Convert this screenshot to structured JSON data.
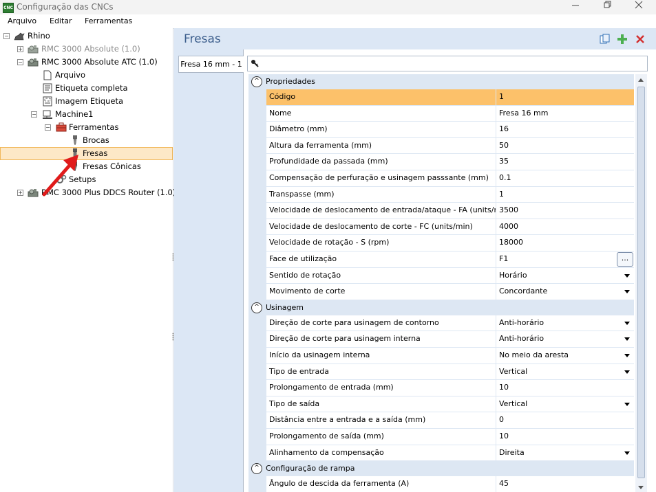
{
  "window": {
    "title": "Configuração das CNCs",
    "app_icon": "CNC"
  },
  "menu": {
    "items": [
      "Arquivo",
      "Editar",
      "Ferramentas"
    ]
  },
  "tree": {
    "root": "Rhino",
    "machines": [
      "RMC 3000 Absolute (1.0)",
      "RMC 3000 Absolute ATC (1.0)",
      "RMC 3000 Plus DDCS Router (1.0)"
    ],
    "files": [
      "Arquivo",
      "Etiqueta completa",
      "Imagem Etiqueta"
    ],
    "machine_node": "Machine1",
    "tools_folder": "Ferramentas",
    "tool_types": [
      "Brocas",
      "Fresas",
      "Fresas Cônicas"
    ],
    "setups": "Setups",
    "selected": "Fresas"
  },
  "panel": {
    "title": "Fresas",
    "tab": "Fresa 16 mm - 1"
  },
  "colors": {
    "selected_row": "#fcc16a",
    "delete_icon": "#d32f2f",
    "add_icon": "#4caf50",
    "title": "#3d5f8d"
  },
  "grid": {
    "categories": [
      {
        "label": "Propriedades",
        "rows": [
          {
            "name": "Código",
            "value": "1"
          },
          {
            "name": "Nome",
            "value": "Fresa 16 mm"
          },
          {
            "name": "Diâmetro (mm)",
            "value": "16"
          },
          {
            "name": "Altura da ferramenta (mm)",
            "value": "50"
          },
          {
            "name": "Profundidade da passada (mm)",
            "value": "35"
          },
          {
            "name": "Compensação de perfuração e usinagem passsante (mm)",
            "value": "0.1"
          },
          {
            "name": "Transpasse (mm)",
            "value": "1"
          },
          {
            "name": "Velocidade de deslocamento de entrada/ataque - FA (units/min)",
            "value": "3500"
          },
          {
            "name": "Velocidade de deslocamento de corte - FC (units/min)",
            "value": "4000"
          },
          {
            "name": "Velocidade de rotação - S (rpm)",
            "value": "18000"
          },
          {
            "name": "Face de utilização",
            "value": "F1"
          },
          {
            "name": "Sentido de rotação",
            "value": "Horário"
          },
          {
            "name": "Movimento de corte",
            "value": "Concordante"
          }
        ]
      },
      {
        "label": "Usinagem",
        "rows": [
          {
            "name": "Direção de corte para usinagem de contorno",
            "value": "Anti-horário"
          },
          {
            "name": "Direção de corte para usinagem interna",
            "value": "Anti-horário"
          },
          {
            "name": "Início da usinagem interna",
            "value": "No meio da aresta"
          },
          {
            "name": "Tipo de entrada",
            "value": "Vertical"
          },
          {
            "name": "Prolongamento de entrada (mm)",
            "value": "10"
          },
          {
            "name": "Tipo de saída",
            "value": "Vertical"
          },
          {
            "name": "Distância entre a entrada e a saída (mm)",
            "value": "0"
          },
          {
            "name": "Prolongamento de saída (mm)",
            "value": "10"
          },
          {
            "name": "Alinhamento da compensação",
            "value": "Direita"
          }
        ]
      },
      {
        "label": "Configuração de rampa",
        "rows": [
          {
            "name": "Ângulo de descida da ferramenta (A)",
            "value": "45"
          }
        ]
      }
    ]
  }
}
